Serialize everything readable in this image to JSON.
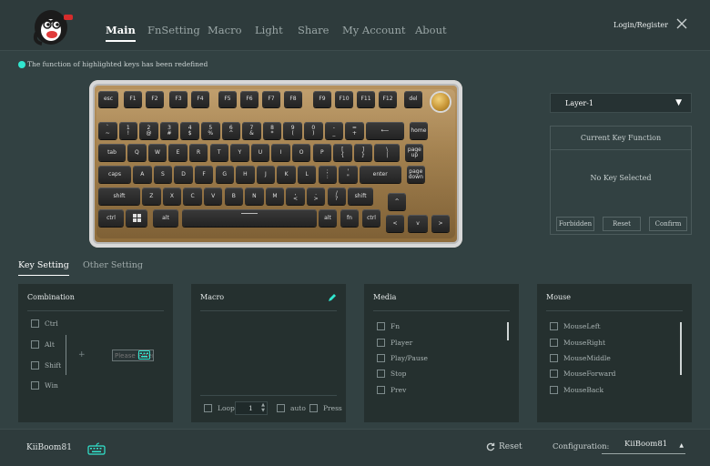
{
  "header": {
    "tabs": [
      "Main",
      "FnSetting",
      "Macro",
      "Light",
      "Share",
      "My Account",
      "About"
    ],
    "active_tab": "Main",
    "login": "Login/Register"
  },
  "hint": "The function of highlighted keys has been redefined",
  "keyboard": {
    "row0": [
      "esc",
      "F1",
      "F2",
      "F3",
      "F4",
      "F5",
      "F6",
      "F7",
      "F8",
      "F9",
      "F10",
      "F11",
      "F12",
      "del"
    ],
    "row1": [
      "`\n~",
      "1\n!",
      "2\n@",
      "3\n#",
      "4\n$",
      "5\n%",
      "6\n^",
      "7\n&",
      "8\n*",
      "9\n(",
      "0\n)",
      "-\n_",
      "=\n+",
      "⟵",
      "home"
    ],
    "row2": [
      "tab",
      "Q",
      "W",
      "E",
      "R",
      "T",
      "Y",
      "U",
      "I",
      "O",
      "P",
      "[\n{",
      "]\n}",
      "\\\n|",
      "page\nup"
    ],
    "row3": [
      "caps",
      "A",
      "S",
      "D",
      "F",
      "G",
      "H",
      "J",
      "K",
      "L",
      ";\n:",
      "'\n\"",
      "enter",
      "page\ndown"
    ],
    "row4": [
      "shift",
      "Z",
      "X",
      "C",
      "V",
      "B",
      "N",
      "M",
      ",\n<",
      ".\n>",
      "/\n?",
      "shift",
      "^"
    ],
    "row5": [
      "ctrl",
      "",
      "alt",
      "",
      "alt",
      "fn",
      "ctrl",
      "<",
      "v",
      ">"
    ]
  },
  "layer": {
    "selected": "Layer-1"
  },
  "current_key": {
    "title": "Current Key Function",
    "status": "No Key Selected",
    "buttons": [
      "Forbidden",
      "Reset",
      "Confirm"
    ]
  },
  "setting_tabs": [
    "Key Setting",
    "Other Setting"
  ],
  "panels": {
    "combination": {
      "title": "Combination",
      "items": [
        "Ctrl",
        "Alt",
        "Shift",
        "Win"
      ],
      "plus": "+",
      "placeholder": "Please Enter"
    },
    "macro": {
      "title": "Macro",
      "loop": "Loop",
      "count": "1",
      "auto": "auto",
      "press": "Press"
    },
    "media": {
      "title": "Media",
      "items": [
        "Fn",
        "Player",
        "Play/Pause",
        "Stop",
        "Prev"
      ]
    },
    "mouse": {
      "title": "Mouse",
      "items": [
        "MouseLeft",
        "MouseRight",
        "MouseMiddle",
        "MouseForward",
        "MouseBack"
      ]
    }
  },
  "footer": {
    "device": "KiiBoom81",
    "reset": "Reset",
    "config_label": "Configuration:",
    "config_value": "KiiBoom81"
  },
  "colors": {
    "accent": "#31e6cf",
    "bg": "#324142",
    "panel": "#25302f"
  }
}
